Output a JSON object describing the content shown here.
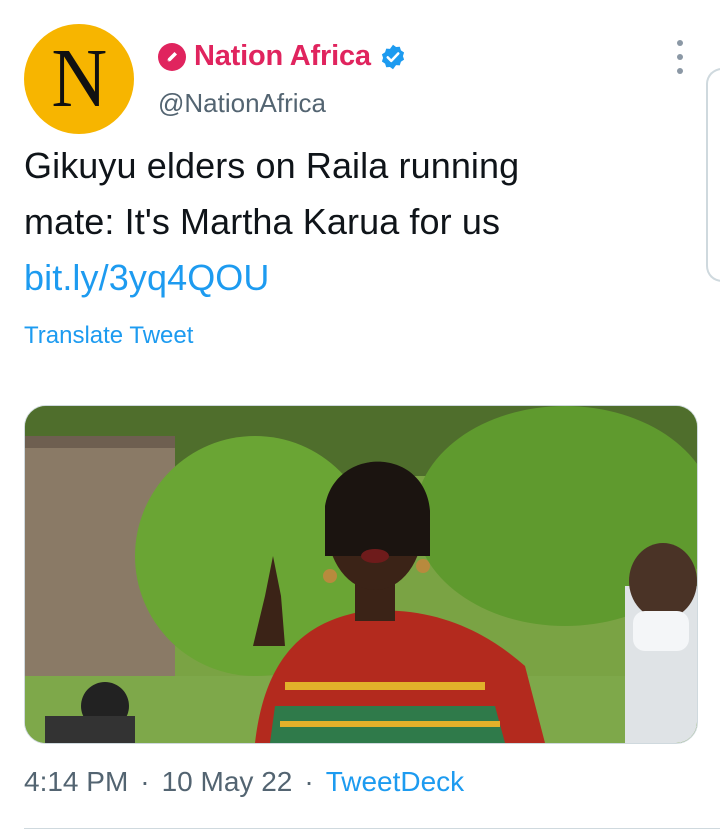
{
  "author": {
    "avatar_letter": "N",
    "display_name": "Nation Africa",
    "handle": "@NationAfrica",
    "badge_icon": "organization-pen-icon",
    "verified_icon": "verified-check-icon"
  },
  "tweet": {
    "text_line1": "Gikuyu elders on Raila running",
    "text_line2": "mate: It's Martha Karua for us",
    "link": "bit.ly/3yq4QOU",
    "translate_label": "Translate Tweet"
  },
  "meta": {
    "time": "4:14 PM",
    "separator": "·",
    "date": "10 May 22",
    "source": "TweetDeck"
  },
  "colors": {
    "accent": "#1d9bf0",
    "name": "#e0245e",
    "avatar_bg": "#f7b500"
  }
}
